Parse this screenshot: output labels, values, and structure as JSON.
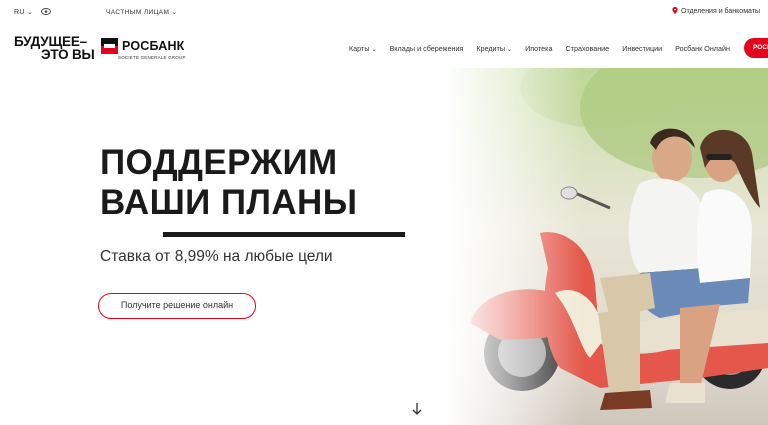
{
  "topbar": {
    "language": "RU",
    "segment": "ЧАСТНЫМ ЛИЦАМ",
    "branches": "Отделения и банкоматы",
    "icons": [
      "chevron-down-icon",
      "eye-icon",
      "map-pin-icon"
    ]
  },
  "brand": {
    "slogan_line1": "БУДУЩЕЕ–",
    "slogan_line2": "ЭТО ВЫ",
    "logo_text": "РОСБАНК",
    "logo_subtitle": "SOCIETE GENERALE GROUP",
    "accent_color": "#e3051b"
  },
  "nav": {
    "items": [
      {
        "label": "Карты",
        "dropdown": true
      },
      {
        "label": "Вклады и сбережения",
        "dropdown": false
      },
      {
        "label": "Кредиты",
        "dropdown": true
      },
      {
        "label": "Ипотека",
        "dropdown": false
      },
      {
        "label": "Страхование",
        "dropdown": false
      },
      {
        "label": "Инвестиции",
        "dropdown": false
      },
      {
        "label": "Росбанк Онлайн",
        "dropdown": false
      }
    ],
    "cta_label": "РОСБ"
  },
  "hero": {
    "headline_line1": "ПОДДЕРЖИМ",
    "headline_line2": "ВАШИ ПЛАНЫ",
    "subline": "Ставка от 8,99% на любые цели",
    "cta_label": "Получите решение онлайн",
    "scroll_icon": "arrow-down-icon"
  }
}
